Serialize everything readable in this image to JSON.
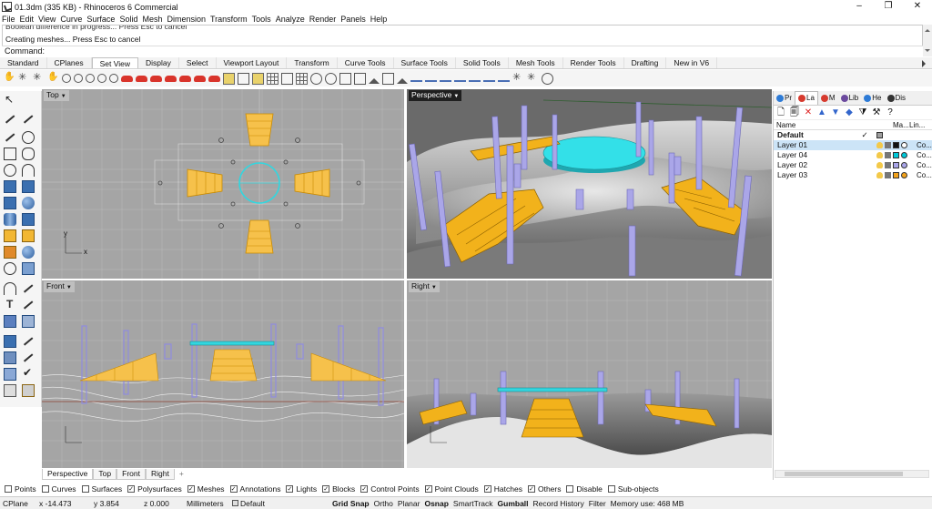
{
  "window": {
    "title": "01.3dm (335 KB) - Rhinoceros 6 Commercial",
    "controls": [
      "–",
      "❐",
      "✕"
    ]
  },
  "menu": [
    "File",
    "Edit",
    "View",
    "Curve",
    "Surface",
    "Solid",
    "Mesh",
    "Dimension",
    "Transform",
    "Tools",
    "Analyze",
    "Render",
    "Panels",
    "Help"
  ],
  "command_history": {
    "line1": "Boolean difference in progress... Press Esc to cancel",
    "line2": "Creating meshes... Press Esc to cancel",
    "prompt_label": "Command:",
    "prompt_value": ""
  },
  "toolbar_tabs": [
    "Standard",
    "CPlanes",
    "Set View",
    "Display",
    "Select",
    "Viewport Layout",
    "Transform",
    "Curve Tools",
    "Surface Tools",
    "Solid Tools",
    "Mesh Tools",
    "Render Tools",
    "Drafting",
    "New in V6"
  ],
  "active_toolbar_tab": "Set View",
  "viewports": {
    "top": "Top",
    "perspective": "Perspective",
    "front": "Front",
    "right": "Right"
  },
  "viewport_tabs": [
    "Perspective",
    "Top",
    "Front",
    "Right"
  ],
  "viewport_tab_add": "+",
  "axis": {
    "x": "x",
    "y": "y"
  },
  "panel": {
    "tabs": [
      "Pr",
      "La",
      "M",
      "Lib",
      "He",
      "Dis"
    ],
    "columns": {
      "name": "Name",
      "material": "Ma...",
      "linetype": "Lin..."
    },
    "layers": [
      {
        "name": "Default",
        "current": "✓",
        "color": "#9e9e9e",
        "linetype": "",
        "bold": true
      },
      {
        "name": "Layer 01",
        "current": "",
        "color": "#111111",
        "linetype": "Co...",
        "selected": true
      },
      {
        "name": "Layer 04",
        "current": "",
        "color": "#00c8d8",
        "linetype": "Co..."
      },
      {
        "name": "Layer 02",
        "current": "",
        "color": "#a9a5e8",
        "linetype": "Co..."
      },
      {
        "name": "Layer 03",
        "current": "",
        "color": "#f2a21b",
        "linetype": "Co..."
      }
    ]
  },
  "osnap": [
    {
      "label": "Points",
      "checked": false
    },
    {
      "label": "Curves",
      "checked": false
    },
    {
      "label": "Surfaces",
      "checked": false
    },
    {
      "label": "Polysurfaces",
      "checked": true
    },
    {
      "label": "Meshes",
      "checked": true
    },
    {
      "label": "Annotations",
      "checked": true
    },
    {
      "label": "Lights",
      "checked": true
    },
    {
      "label": "Blocks",
      "checked": true
    },
    {
      "label": "Control Points",
      "checked": true
    },
    {
      "label": "Point Clouds",
      "checked": true
    },
    {
      "label": "Hatches",
      "checked": true
    },
    {
      "label": "Others",
      "checked": true
    },
    {
      "label": "Disable",
      "checked": false
    },
    {
      "label": "Sub-objects",
      "checked": false
    }
  ],
  "status": {
    "cplane": "CPlane",
    "x": "x -14.473",
    "y": "y 3.854",
    "z": "z 0.000",
    "units": "Millimeters",
    "layer": "Default",
    "grid_snap": "Grid Snap",
    "ortho": "Ortho",
    "planar": "Planar",
    "osnap": "Osnap",
    "smarttrack": "SmartTrack",
    "gumball": "Gumball",
    "record_history": "Record History",
    "filter": "Filter",
    "memory": "Memory use: 468 MB"
  },
  "colors": {
    "stairs": "#f2b21b",
    "columns": "#a9a5e8",
    "platform": "#33d6df",
    "terrain": "#8c8c8c"
  }
}
